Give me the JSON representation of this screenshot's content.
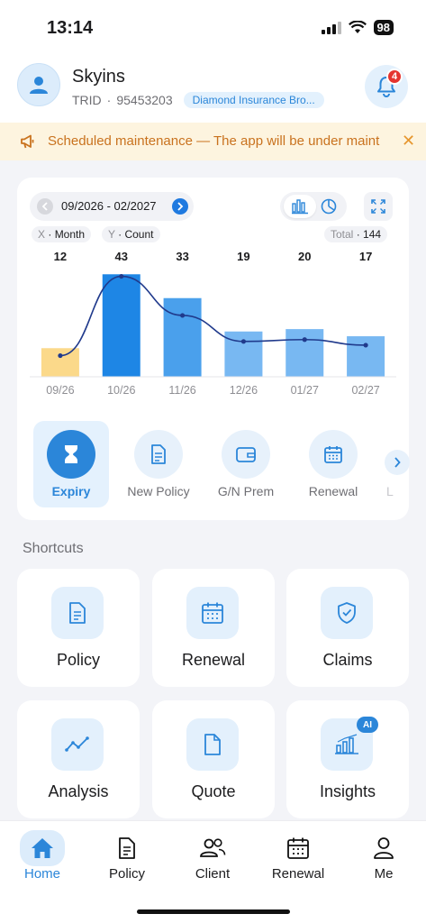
{
  "status": {
    "time": "13:14",
    "battery": "98"
  },
  "user": {
    "name": "Skyins",
    "trid_label": "TRID",
    "trid": "95453203",
    "agency": "Diamond Insurance Bro..."
  },
  "notifications": {
    "count": "4"
  },
  "notice": {
    "text": "Scheduled maintenance — The app will be under maint"
  },
  "chart_controls": {
    "range": "09/2026 - 02/2027",
    "x_key": "X",
    "x_value": "Month",
    "y_key": "Y",
    "y_value": "Count",
    "total_label": "Total",
    "total_value": "144"
  },
  "chart_data": {
    "type": "bar",
    "categories": [
      "09/26",
      "10/26",
      "11/26",
      "12/26",
      "01/27",
      "02/27"
    ],
    "values": [
      12,
      43,
      33,
      19,
      20,
      17
    ],
    "overlay": "line",
    "bar_colors": [
      "#fbd98a",
      "#1e86e5",
      "#4aa0ec",
      "#78b8f2",
      "#78b8f2",
      "#78b8f2"
    ],
    "line_color": "#203a8c",
    "ylim": [
      0,
      45
    ]
  },
  "metrics": [
    {
      "label": "Expiry",
      "icon": "hourglass-icon",
      "active": true
    },
    {
      "label": "New Policy",
      "icon": "document-icon"
    },
    {
      "label": "G/N Prem",
      "icon": "wallet-icon"
    },
    {
      "label": "Renewal",
      "icon": "calendar-icon"
    },
    {
      "label": "L"
    }
  ],
  "shortcuts": {
    "title": "Shortcuts",
    "items": [
      {
        "label": "Policy",
        "icon": "policy-doc-icon"
      },
      {
        "label": "Renewal",
        "icon": "calendar-icon"
      },
      {
        "label": "Claims",
        "icon": "shield-check-icon"
      },
      {
        "label": "Analysis",
        "icon": "trend-line-icon"
      },
      {
        "label": "Quote",
        "icon": "file-icon"
      },
      {
        "label": "Insights",
        "icon": "bar-chart-icon",
        "badge": "AI"
      }
    ]
  },
  "tabs": [
    {
      "label": "Home",
      "icon": "home-icon",
      "active": true
    },
    {
      "label": "Policy",
      "icon": "document-icon"
    },
    {
      "label": "Client",
      "icon": "users-icon"
    },
    {
      "label": "Renewal",
      "icon": "calendar-icon"
    },
    {
      "label": "Me",
      "icon": "person-icon"
    }
  ],
  "colors": {
    "accent": "#2b86d9",
    "notice_text": "#c9721e",
    "notice_bg": "#fdf4df",
    "badge_red": "#e5342f"
  }
}
